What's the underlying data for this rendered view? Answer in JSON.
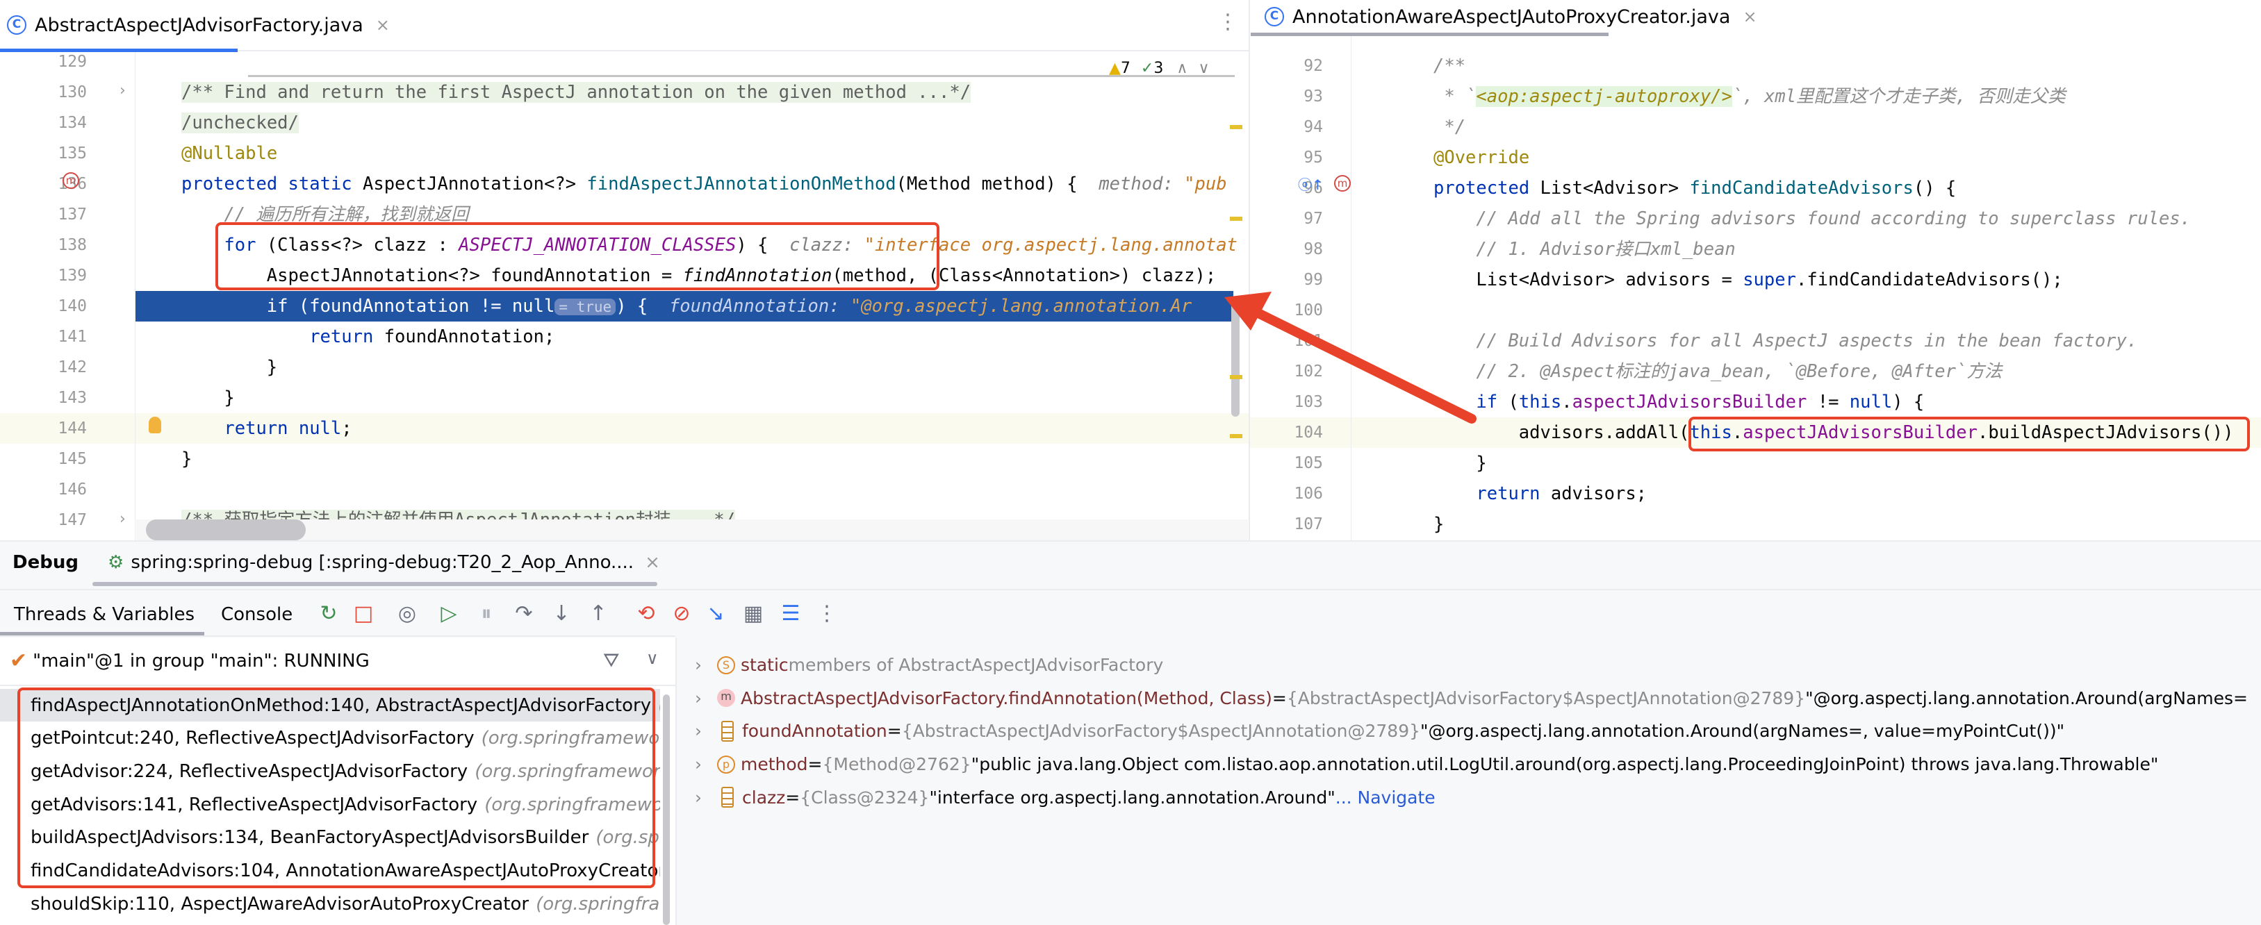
{
  "tabs": {
    "left": "AbstractAspectJAdvisorFactory.java",
    "right": "AnnotationAwareAspectJAutoProxyCreator.java",
    "more": "⋮",
    "close": "×",
    "class_icon": "C"
  },
  "inspections": {
    "warnings": "7",
    "typos": "3"
  },
  "editor_left": {
    "lines": [
      {
        "n": "129",
        "i": 0,
        "t": []
      },
      {
        "n": "130",
        "i": 0,
        "t": [
          {
            "c": "doc",
            "s": "/** Find and return the first AspectJ annotation on the given method ...*/"
          }
        ]
      },
      {
        "n": "134",
        "i": 0,
        "t": [
          {
            "c": "doc",
            "s": "/unchecked/"
          }
        ]
      },
      {
        "n": "135",
        "i": 0,
        "t": [
          {
            "c": "an",
            "s": "@Nullable"
          }
        ]
      },
      {
        "n": "136",
        "i": 0,
        "t": [
          {
            "c": "kw",
            "s": "protected static "
          },
          {
            "c": "pl",
            "s": "AspectJAnnotation<?> "
          },
          {
            "c": "fn",
            "s": "findAspectJAnnotationOnMethod"
          },
          {
            "c": "pl",
            "s": "(Method method) {  "
          },
          {
            "c": "hn",
            "s": "method: "
          },
          {
            "c": "hv",
            "s": "\"pub"
          }
        ]
      },
      {
        "n": "137",
        "i": 1,
        "t": [
          {
            "c": "cm",
            "s": "// 遍历所有注解，找到就返回"
          }
        ]
      },
      {
        "n": "138",
        "i": 1,
        "t": [
          {
            "c": "kw",
            "s": "for "
          },
          {
            "c": "pl",
            "s": "(Class<?> clazz : "
          },
          {
            "c": "cst",
            "s": "ASPECTJ_ANNOTATION_CLASSES"
          },
          {
            "c": "pl",
            "s": ") {  "
          },
          {
            "c": "hn",
            "s": "clazz: "
          },
          {
            "c": "hv",
            "s": "\"interface org.aspectj.lang.annotat"
          }
        ]
      },
      {
        "n": "139",
        "i": 2,
        "t": [
          {
            "c": "pl",
            "s": "AspectJAnnotation<?> foundAnnotation = "
          },
          {
            "c": "pl it",
            "s": "findAnnotation"
          },
          {
            "c": "pl",
            "s": "(method, (Class<Annotation>) clazz);"
          }
        ]
      },
      {
        "n": "140",
        "i": 2,
        "t": [
          {
            "c": "kw",
            "s": "if "
          },
          {
            "c": "pl",
            "s": "(foundAnnotation != null"
          },
          {
            "c": "chip",
            "s": "= true"
          },
          {
            "c": "pl",
            "s": ") {  "
          },
          {
            "c": "hn",
            "s": "foundAnnotation: "
          },
          {
            "c": "hv",
            "s": "\"@org.aspectj.lang.annotation.Ar"
          }
        ]
      },
      {
        "n": "141",
        "i": 3,
        "t": [
          {
            "c": "kw",
            "s": "return "
          },
          {
            "c": "pl",
            "s": "foundAnnotation;"
          }
        ]
      },
      {
        "n": "142",
        "i": 2,
        "t": [
          {
            "c": "pl",
            "s": "}"
          }
        ]
      },
      {
        "n": "143",
        "i": 1,
        "t": [
          {
            "c": "pl",
            "s": "}"
          }
        ]
      },
      {
        "n": "144",
        "i": 1,
        "t": [
          {
            "c": "kw",
            "s": "return null"
          },
          {
            "c": "pl",
            "s": ";"
          }
        ]
      },
      {
        "n": "145",
        "i": 0,
        "t": [
          {
            "c": "pl",
            "s": "}"
          }
        ]
      },
      {
        "n": "146",
        "i": 0,
        "t": []
      },
      {
        "n": "147",
        "i": 0,
        "t": [
          {
            "c": "doc",
            "s": "/** 获取指定方法上的注解并使用AspectJAnnotation封装 ...*/"
          }
        ]
      }
    ]
  },
  "editor_right": {
    "lines": [
      {
        "n": "92",
        "i": 0,
        "t": [
          {
            "c": "cm",
            "s": "/**"
          }
        ]
      },
      {
        "n": "93",
        "i": 0,
        "t": [
          {
            "c": "cm",
            "s": " * `"
          },
          {
            "c": "tag",
            "s": "<aop:aspectj-autoproxy/>"
          },
          {
            "c": "cm",
            "s": "`, xml里配置这个才走子类, 否则走父类"
          }
        ]
      },
      {
        "n": "94",
        "i": 0,
        "t": [
          {
            "c": "cm",
            "s": " */"
          }
        ]
      },
      {
        "n": "95",
        "i": 0,
        "t": [
          {
            "c": "an",
            "s": "@Override"
          }
        ]
      },
      {
        "n": "96",
        "i": 0,
        "t": [
          {
            "c": "kw",
            "s": "protected "
          },
          {
            "c": "pl",
            "s": "List<Advisor> "
          },
          {
            "c": "fn",
            "s": "findCandidateAdvisors"
          },
          {
            "c": "pl",
            "s": "() {"
          }
        ]
      },
      {
        "n": "97",
        "i": 1,
        "t": [
          {
            "c": "cm",
            "s": "// Add all the Spring advisors found according to superclass rules."
          }
        ]
      },
      {
        "n": "98",
        "i": 1,
        "t": [
          {
            "c": "cm",
            "s": "// 1. Advisor接口xml_bean"
          }
        ]
      },
      {
        "n": "99",
        "i": 1,
        "t": [
          {
            "c": "pl",
            "s": "List<Advisor> advisors = "
          },
          {
            "c": "kw",
            "s": "super"
          },
          {
            "c": "pl",
            "s": ".findCandidateAdvisors();"
          }
        ]
      },
      {
        "n": "100",
        "i": 0,
        "t": []
      },
      {
        "n": "101",
        "i": 1,
        "t": [
          {
            "c": "cm",
            "s": "// Build Advisors for all AspectJ aspects in the bean factory."
          }
        ]
      },
      {
        "n": "102",
        "i": 1,
        "t": [
          {
            "c": "cm",
            "s": "// 2. @Aspect标注的java_bean, `@Before, @After`方法"
          }
        ]
      },
      {
        "n": "103",
        "i": 1,
        "t": [
          {
            "c": "kw",
            "s": "if "
          },
          {
            "c": "pl",
            "s": "("
          },
          {
            "c": "kw",
            "s": "this"
          },
          {
            "c": "pl",
            "s": "."
          },
          {
            "c": "fld",
            "s": "aspectJAdvisorsBuilder"
          },
          {
            "c": "pl",
            "s": " != "
          },
          {
            "c": "kw",
            "s": "null"
          },
          {
            "c": "pl",
            "s": ") {"
          }
        ]
      },
      {
        "n": "104",
        "i": 2,
        "t": [
          {
            "c": "pl",
            "s": "advisors.addAll("
          },
          {
            "c": "kw",
            "s": "this"
          },
          {
            "c": "pl",
            "s": "."
          },
          {
            "c": "fld",
            "s": "aspectJAdvisorsBuilder"
          },
          {
            "c": "pl",
            "s": ".buildAspectJAdvisors())"
          }
        ]
      },
      {
        "n": "105",
        "i": 1,
        "t": [
          {
            "c": "pl",
            "s": "}"
          }
        ]
      },
      {
        "n": "106",
        "i": 1,
        "t": [
          {
            "c": "kw",
            "s": "return "
          },
          {
            "c": "pl",
            "s": "advisors;"
          }
        ]
      },
      {
        "n": "107",
        "i": 0,
        "t": [
          {
            "c": "pl",
            "s": "}"
          }
        ]
      }
    ]
  },
  "debug": {
    "title": "Debug",
    "session": "spring:spring-debug [:spring-debug:T20_2_Aop_Anno....",
    "tabs": [
      "Threads & Variables",
      "Console"
    ],
    "toolbar": [
      {
        "icon": "rerun-icon",
        "g": "↻",
        "color": "#3E8F4E"
      },
      {
        "icon": "stop-icon",
        "g": "□",
        "color": "#E5493A"
      },
      {
        "icon": "view-breakpoints-icon",
        "g": "◎",
        "color": "#6C707E"
      },
      {
        "icon": "resume-icon",
        "g": "▷",
        "color": "#3E8F4E"
      },
      {
        "icon": "pause-icon",
        "g": "⏸",
        "color": "#B0B3BC"
      },
      {
        "icon": "step-over-icon",
        "g": "↷",
        "color": "#6C707E"
      },
      {
        "icon": "step-into-icon",
        "g": "↓",
        "color": "#6C707E"
      },
      {
        "icon": "step-out-icon",
        "g": "↑",
        "color": "#6C707E"
      },
      {
        "icon": "reset-frame-icon",
        "g": "⟲",
        "color": "#E5493A"
      },
      {
        "icon": "mute-breakpoints-icon",
        "g": "⊘",
        "color": "#E5493A"
      },
      {
        "icon": "run-to-cursor-icon",
        "g": "↘",
        "color": "#3574F0"
      },
      {
        "icon": "evaluate-icon",
        "g": "▦",
        "color": "#6C707E"
      },
      {
        "icon": "layout-icon",
        "g": "☰",
        "color": "#3574F0"
      },
      {
        "icon": "more-icon",
        "g": "⋮",
        "color": "#6C707E"
      }
    ],
    "thread": "\"main\"@1 in group \"main\": RUNNING",
    "frames": [
      {
        "m": "findAspectJAnnotationOnMethod:140, AbstractAspectJAdvisorFactory",
        "p": "(o"
      },
      {
        "m": "getPointcut:240, ReflectiveAspectJAdvisorFactory",
        "p": "(org.springframework"
      },
      {
        "m": "getAdvisor:224, ReflectiveAspectJAdvisorFactory",
        "p": "(org.springframework."
      },
      {
        "m": "getAdvisors:141, ReflectiveAspectJAdvisorFactory",
        "p": "(org.springframework"
      },
      {
        "m": "buildAspectJAdvisors:134, BeanFactoryAspectJAdvisorsBuilder",
        "p": "(org.spri"
      },
      {
        "m": "findCandidateAdvisors:104, AnnotationAwareAspectJAutoProxyCreator",
        "p": "("
      },
      {
        "m": "shouldSkip:110, AspectJAwareAdvisorAutoProxyCreator",
        "p": "(org.springframe"
      }
    ],
    "variables": [
      {
        "icon": "static-icon",
        "ig": "S",
        "name": "static",
        "rest": " members of AbstractAspectJAdvisorFactory",
        "type": "",
        "val": "",
        "link": ""
      },
      {
        "icon": "method-return-icon",
        "ig": "m",
        "name": "AbstractAspectJAdvisorFactory.findAnnotation(Method, Class)",
        "rest": " = ",
        "type": "{AbstractAspectJAdvisorFactory$AspectJAnnotation@2789}",
        "val": " \"@org.aspectj.lang.annotation.Around(argNames=",
        "link": ""
      },
      {
        "icon": "field-icon",
        "ig": "",
        "name": "foundAnnotation",
        "rest": " = ",
        "type": "{AbstractAspectJAdvisorFactory$AspectJAnnotation@2789}",
        "val": " \"@org.aspectj.lang.annotation.Around(argNames=, value=myPointCut())\"",
        "link": ""
      },
      {
        "icon": "parameter-icon",
        "ig": "p",
        "name": "method",
        "rest": " = ",
        "type": "{Method@2762}",
        "val": " \"public java.lang.Object com.listao.aop.annotation.util.LogUtil.around(org.aspectj.lang.ProceedingJoinPoint) throws java.lang.Throwable\"",
        "link": ""
      },
      {
        "icon": "field-icon",
        "ig": "",
        "name": "clazz",
        "rest": " = ",
        "type": "{Class@2324}",
        "val": " \"interface org.aspectj.lang.annotation.Around\"",
        "link": " ... Navigate"
      }
    ]
  },
  "colors": {
    "accent": "#3574F0",
    "exec_line": "#2154A3",
    "annotation_box": "#E8432A"
  }
}
